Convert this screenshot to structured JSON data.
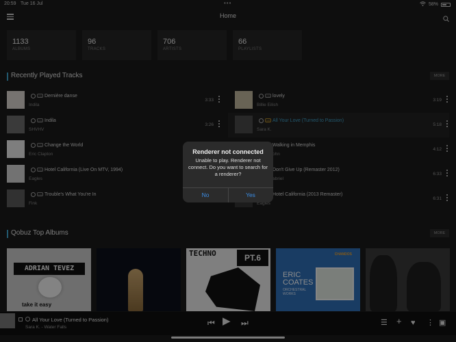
{
  "status": {
    "time": "20:59",
    "date": "Tue 16 Jul",
    "battery": "58%"
  },
  "header": {
    "title": "Home"
  },
  "stats": [
    {
      "value": "1133",
      "label": "ALBUMS"
    },
    {
      "value": "96",
      "label": "TRACKS"
    },
    {
      "value": "706",
      "label": "ARTISTS"
    },
    {
      "value": "66",
      "label": "PLAYLISTS"
    }
  ],
  "recent": {
    "title": "Recently Played Tracks",
    "more": "MORE",
    "tracks": [
      {
        "title": "Dernière danse",
        "artist": "Indila",
        "duration": "3:33"
      },
      {
        "title": "lovely",
        "artist": "Billie Eilish",
        "duration": "3:19"
      },
      {
        "title": "Indila",
        "artist": "SHVHV",
        "duration": "3:26"
      },
      {
        "title": "All Your Love (Turned to Passion)",
        "artist": "Sara K.",
        "duration": "5:18"
      },
      {
        "title": "Change the World",
        "artist": "Eric Clapton",
        "duration": ""
      },
      {
        "title": "Walking in Memphis",
        "artist": "ohn",
        "duration": "4:12"
      },
      {
        "title": "Hotel California (Live On MTV, 1994)",
        "artist": "Eagles",
        "duration": ""
      },
      {
        "title": "Don't Give Up (Remaster 2012)",
        "artist": "abriel",
        "duration": "6:33"
      },
      {
        "title": "Trouble's What You're In",
        "artist": "Fink",
        "duration": ""
      },
      {
        "title": "Hotel California  (2013 Remaster)",
        "artist": "Eagles",
        "duration": "6:31"
      }
    ]
  },
  "qobuz": {
    "title": "Qobuz Top Albums",
    "more": "MORE",
    "albums": [
      {
        "cover_top": "ADRIAN TEVEZ",
        "cover_bottom": "take it easy"
      },
      {},
      {
        "cover_side": "TECHNO",
        "cover_corner": "PT.6"
      },
      {
        "label": "CHANDOS",
        "cover_name": "ERIC COATES",
        "cover_sub": "ORCHESTRAL WORKS"
      },
      {}
    ]
  },
  "player": {
    "title": "All Your Love (Turned to Passion)",
    "subtitle": "Sara K. - Water Falls",
    "queue_count": "2"
  },
  "dialog": {
    "title": "Renderer not connected",
    "message": "Unable to play. Renderer not connect. Do you want to search for a renderer?",
    "no": "No",
    "yes": "Yes"
  }
}
